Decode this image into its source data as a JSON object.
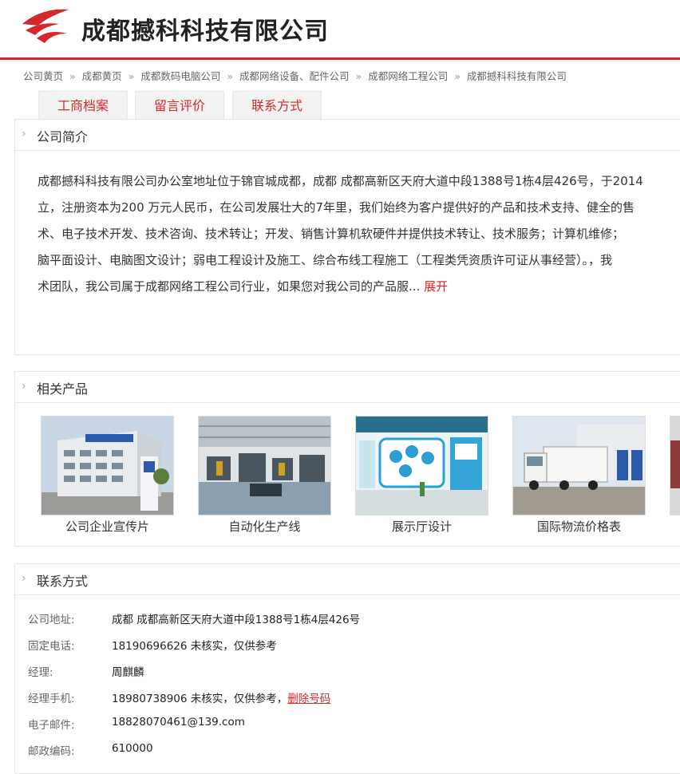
{
  "header": {
    "company_name": "成都撼科科技有限公司",
    "logo": "red-swoosh-logo"
  },
  "breadcrumb": [
    "公司黄页",
    "成都黄页",
    "成都数码电脑公司",
    "成都网络设备、配件公司",
    "成都网络工程公司",
    "成都撼科科技有限公司"
  ],
  "breadcrumb_separator": "»",
  "tabs": [
    "工商档案",
    "留言评价",
    "联系方式"
  ],
  "intro": {
    "title": "公司简介",
    "lines": [
      "成都撼科科技有限公司办公室地址位于锦官城成都，成都 成都高新区天府大道中段1388号1栋4层426号，于2014",
      "立，注册资本为200 万元人民币，在公司发展壮大的7年里，我们始终为客户提供好的产品和技术支持、健全的售",
      "术、电子技术开发、技术咨询、技术转让；开发、销售计算机软硬件并提供技术转让、技术服务；计算机维修；",
      "脑平面设计、电脑图文设计；弱电工程设计及施工、综合布线工程施工（工程类凭资质许可证从事经营）。，我",
      "术团队，我公司属于成都网络工程公司行业，如果您对我公司的产品服..."
    ],
    "more_label": "展开"
  },
  "products": {
    "title": "相关产品",
    "items": [
      {
        "label": "公司企业宣传片"
      },
      {
        "label": "自动化生产线"
      },
      {
        "label": "展示厅设计"
      },
      {
        "label": "国际物流价格表"
      }
    ]
  },
  "contact": {
    "title": "联系方式",
    "rows": [
      {
        "label": "公司地址:",
        "value": "成都 成都高新区天府大道中段1388号1栋4层426号"
      },
      {
        "label": "固定电话:",
        "value": "18190696626 未核实，仅供参考"
      },
      {
        "label": "经理:",
        "value": "周麒麟"
      },
      {
        "label": "经理手机:",
        "value": "18980738906 未核实，仅供参考，",
        "link": "删除号码"
      },
      {
        "label": "电子邮件:",
        "value": "18828070461@139.com"
      },
      {
        "label": "邮政编码:",
        "value": "610000"
      }
    ]
  },
  "colors": {
    "accent": "#d4282d",
    "tab_bg": "#f2f2f2",
    "border": "#e5e5e5"
  }
}
